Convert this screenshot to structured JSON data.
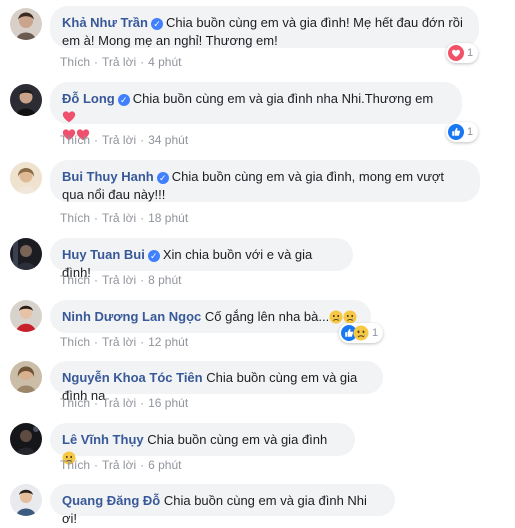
{
  "actions": {
    "like": "Thích",
    "reply": "Trả lời",
    "sep": "·"
  },
  "comments": [
    {
      "name": "Khả Như Trần",
      "text": "Chia buồn cùng em và gia đình! Mẹ hết đau đớn rồi em à! Mong mẹ an nghỉ! Thương em!",
      "time": "4 phút",
      "reaction": {
        "type": "love",
        "count": "1"
      }
    },
    {
      "name": "Đỗ Long",
      "text": "Chia buồn cùng em và gia đình nha Nhi.Thương em",
      "time": "34 phút",
      "reaction": {
        "type": "like",
        "count": "1"
      }
    },
    {
      "name": "Bui Thuy Hanh",
      "text": "Chia buồn cùng em và gia đình, mong em vượt qua nổi đau này!!!",
      "time": "18 phút"
    },
    {
      "name": "Huy Tuan Bui",
      "text": "Xin chia buồn với e và gia đình!",
      "time": "8 phút"
    },
    {
      "name": "Ninh Dương Lan Ngọc",
      "text": "Cố gắng lên nha bà...",
      "time": "12 phút",
      "reaction": {
        "type": "like",
        "count": "1"
      }
    },
    {
      "name": "Nguyễn Khoa Tóc Tiên",
      "text": "Chia buồn cùng em và gia đình na",
      "time": "16 phút"
    },
    {
      "name": "Lê Vĩnh Thụy",
      "text": "Chia buồn cùng em và gia đình",
      "time": "6 phút"
    },
    {
      "name": "Quang Đăng Đỗ",
      "text": "Chia buồn cùng em và gia đình Nhi ơi!",
      "time": ""
    }
  ],
  "icons": {
    "verified": "verified-badge-icon",
    "love": "love-reaction-icon",
    "like": "like-reaction-icon",
    "heart": "red-heart-emoji",
    "sad": "sad-face-emoji"
  },
  "colors": {
    "name": "#385898",
    "bubble": "#f2f3f5",
    "meta": "#90949c",
    "verified": "#4080ff",
    "love": "#f25268",
    "like": "#1877f2"
  }
}
